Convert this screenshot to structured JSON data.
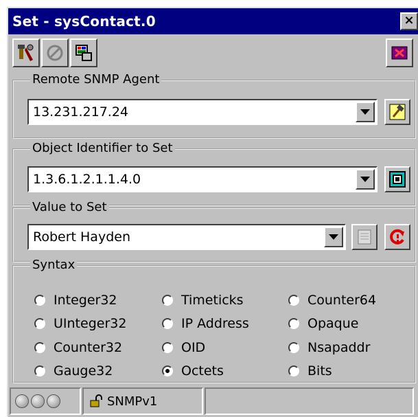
{
  "window": {
    "title": "Set - sysContact.0",
    "close_symbol": "×"
  },
  "toolbar": {
    "icons": [
      "tools-icon",
      "disabled-circle-icon",
      "screen-icon",
      "exit-icon"
    ]
  },
  "agent_group": {
    "legend": "Remote SNMP Agent",
    "value": "13.231.217.24"
  },
  "oid_group": {
    "legend": "Object Identifier to Set",
    "value": "1.3.6.1.2.1.1.4.0"
  },
  "value_group": {
    "legend": "Value to Set",
    "value": "Robert Hayden"
  },
  "syntax": {
    "legend": "Syntax",
    "options": [
      {
        "label": "Integer32",
        "selected": false
      },
      {
        "label": "Timeticks",
        "selected": false
      },
      {
        "label": "Counter64",
        "selected": false
      },
      {
        "label": "UInteger32",
        "selected": false
      },
      {
        "label": "IP Address",
        "selected": false
      },
      {
        "label": "Opaque",
        "selected": false
      },
      {
        "label": "Counter32",
        "selected": false
      },
      {
        "label": "OID",
        "selected": false
      },
      {
        "label": "Nsapaddr",
        "selected": false
      },
      {
        "label": "Gauge32",
        "selected": false
      },
      {
        "label": "Octets",
        "selected": true
      },
      {
        "label": "Bits",
        "selected": false
      }
    ]
  },
  "statusbar": {
    "protocol": "SNMPv1"
  }
}
